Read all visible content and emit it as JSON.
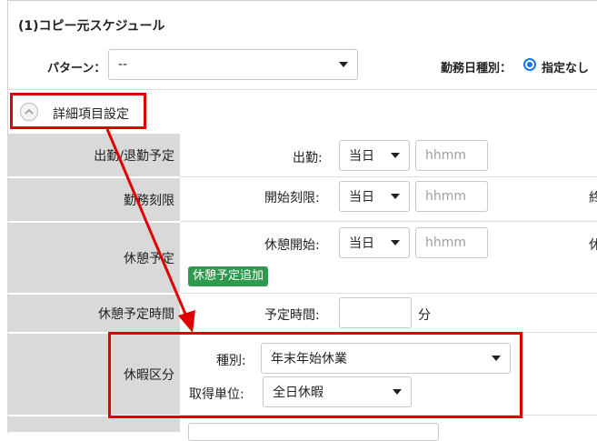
{
  "section": {
    "title": "(1)コピー元スケジュール"
  },
  "pattern": {
    "label": "パターン：",
    "value": "--"
  },
  "work_day_type": {
    "label": "勤務日種別：",
    "value": "指定なし"
  },
  "detail_toggle": {
    "label": "詳細項目設定"
  },
  "rows": {
    "attendance": {
      "label": "出勤/退勤予定",
      "field_label": "出勤:",
      "day_value": "当日",
      "time_placeholder": "hhmm"
    },
    "work_limit": {
      "label": "勤務刻限",
      "field_label": "開始刻限:",
      "day_value": "当日",
      "time_placeholder": "hhmm",
      "clipped_text": "終"
    },
    "break_plan": {
      "label": "休憩予定",
      "field_label": "休憩開始:",
      "day_value": "当日",
      "time_placeholder": "hhmm",
      "clipped_text": "休",
      "add_button": "休憩予定追加"
    },
    "break_time": {
      "label": "休憩予定時間",
      "field_label": "予定時間:",
      "value": "",
      "unit": "分"
    },
    "leave": {
      "label": "休暇区分",
      "type_label": "種別:",
      "type_value": "年末年始休業",
      "unit_label": "取得単位:",
      "unit_value": "全日休暇"
    }
  },
  "colors": {
    "annotation_red": "#e00000",
    "button_green": "#2e9a4d",
    "label_bg": "#d9d9d9",
    "radio_blue": "#1a73e8"
  }
}
